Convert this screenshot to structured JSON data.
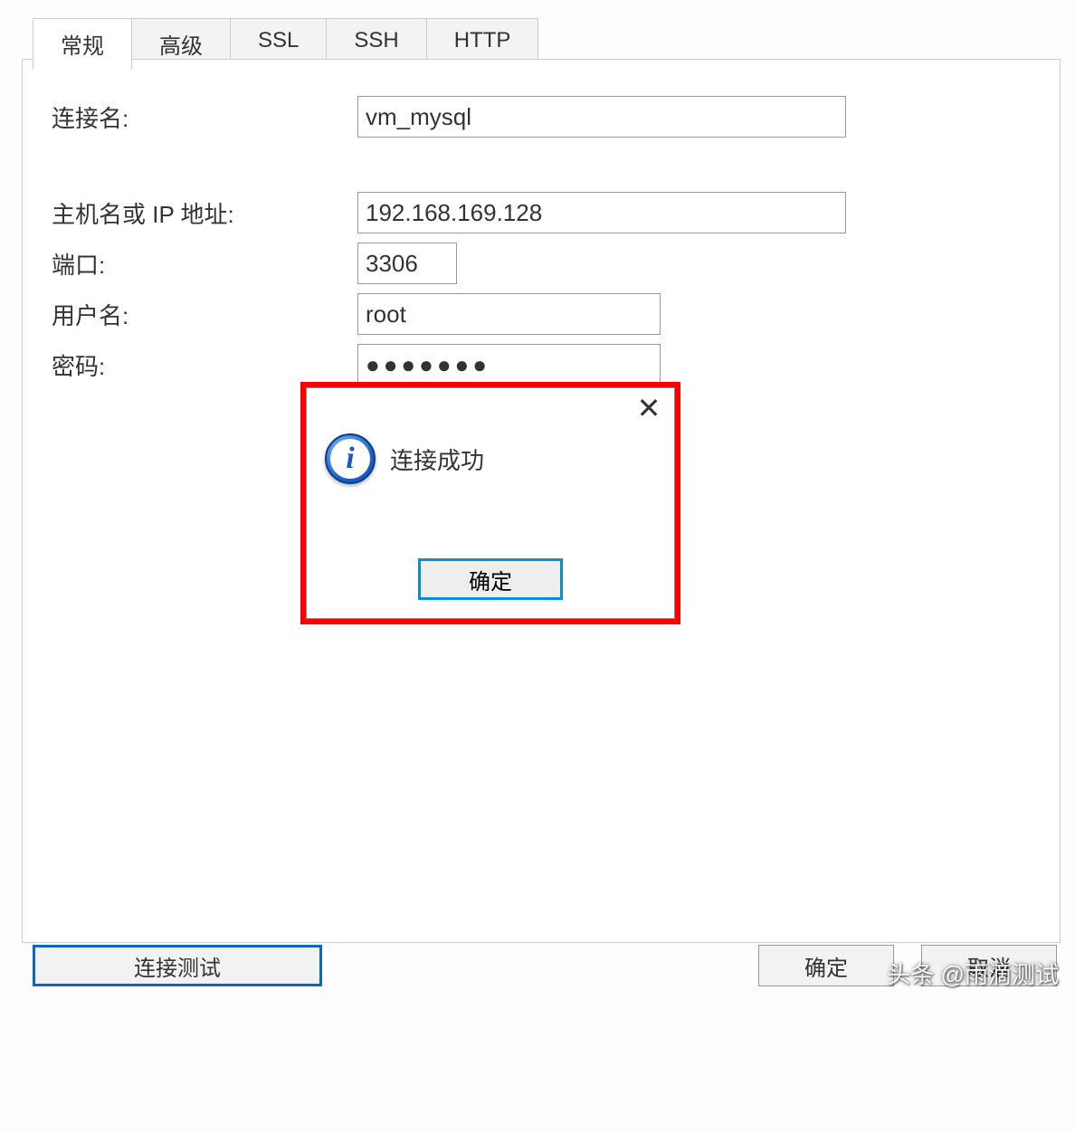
{
  "tabs": {
    "general": "常规",
    "advanced": "高级",
    "ssl": "SSL",
    "ssh": "SSH",
    "http": "HTTP"
  },
  "form": {
    "connection_name_label": "连接名:",
    "connection_name_value": "vm_mysql",
    "host_label": "主机名或 IP 地址:",
    "host_value": "192.168.169.128",
    "port_label": "端口:",
    "port_value": "3306",
    "user_label": "用户名:",
    "user_value": "root",
    "password_label": "密码:",
    "password_value": "●●●●●●●"
  },
  "dialog": {
    "message": "连接成功",
    "ok": "确定"
  },
  "buttons": {
    "test": "连接测试",
    "ok": "确定",
    "cancel": "取消"
  },
  "watermark": "头条 @雨滴测试"
}
